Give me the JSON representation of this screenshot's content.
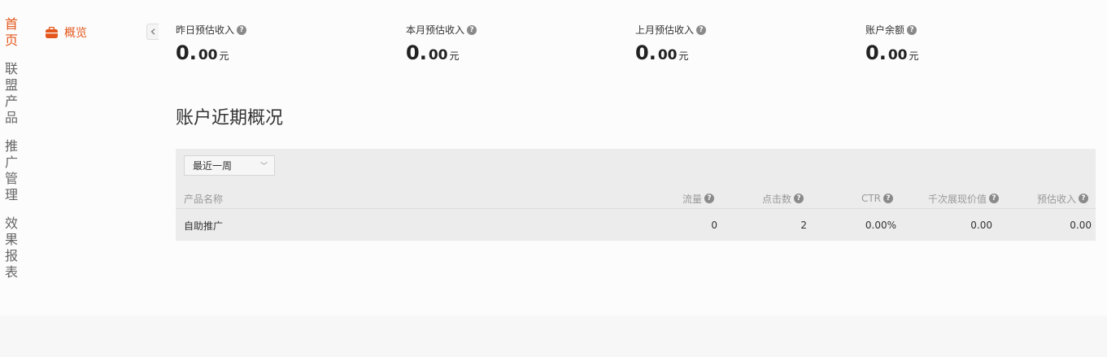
{
  "nav": {
    "items": [
      {
        "label": "首页",
        "active": true
      },
      {
        "label": "联盟产品",
        "active": false
      },
      {
        "label": "推广管理",
        "active": false
      },
      {
        "label": "效果报表",
        "active": false
      }
    ]
  },
  "subnav": {
    "overview_label": "概览",
    "icon": "bag-icon",
    "collapse_icon": "chevron-left-icon"
  },
  "stats": [
    {
      "label": "昨日预估收入",
      "int": "0.",
      "dec": "00",
      "unit": "元"
    },
    {
      "label": "本月预估收入",
      "int": "0.",
      "dec": "00",
      "unit": "元"
    },
    {
      "label": "上月预估收入",
      "int": "0.",
      "dec": "00",
      "unit": "元"
    },
    {
      "label": "账户余额",
      "int": "0.",
      "dec": "00",
      "unit": "元"
    }
  ],
  "section_title": "账户近期概况",
  "filter": {
    "selected": "最近一周"
  },
  "table": {
    "columns": [
      "产品名称",
      "流量",
      "点击数",
      "CTR",
      "千次展现价值",
      "预估收入"
    ],
    "rows": [
      [
        "自助推广",
        "0",
        "2",
        "0.00%",
        "0.00",
        "0.00"
      ]
    ]
  },
  "colors": {
    "accent": "#e4561b",
    "panel": "#ececec"
  }
}
